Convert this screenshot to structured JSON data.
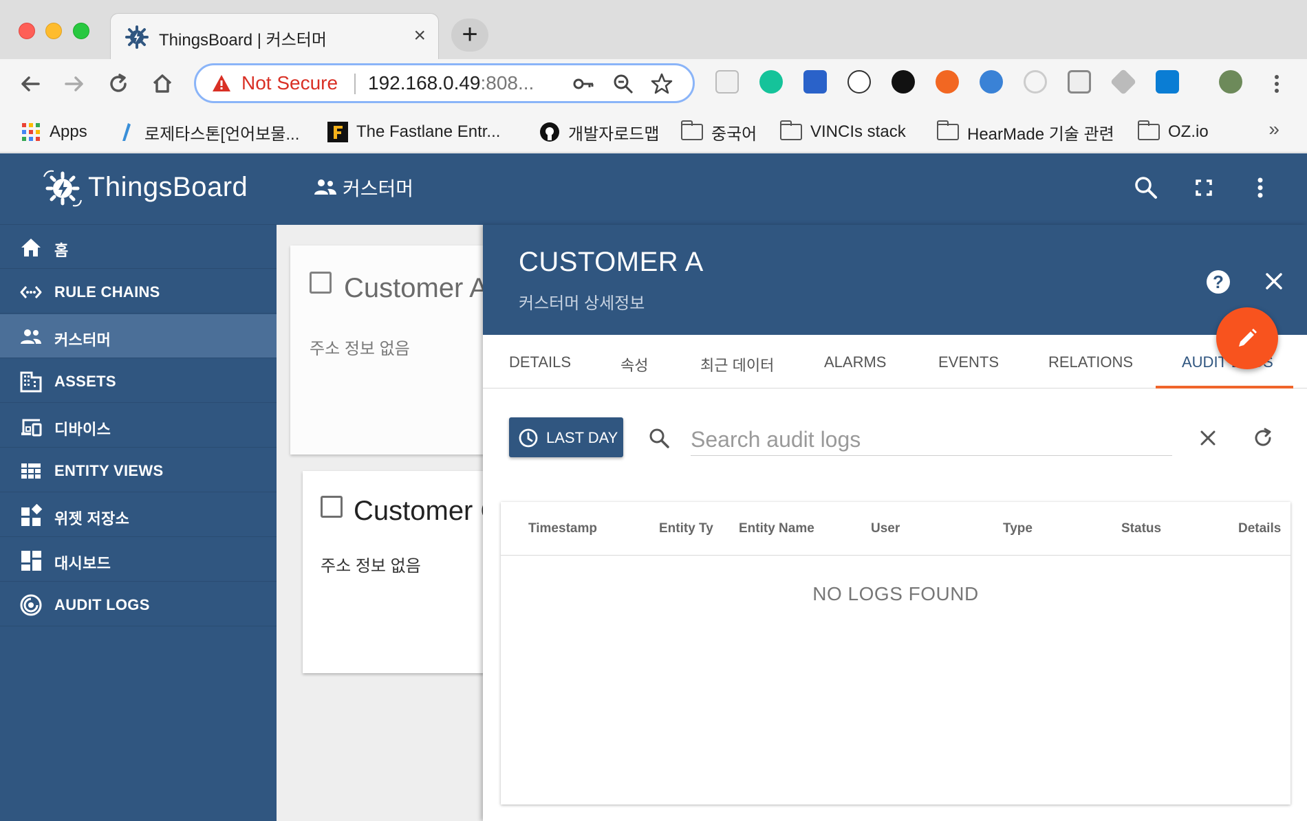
{
  "browser": {
    "tab_title": "ThingsBoard | 커스터머",
    "tab_close": "×",
    "new_tab": "+",
    "security_label": "Not Secure",
    "url_host": "192.168.0.49",
    "url_rest": ":808...",
    "extensions": [
      "pocket-icon",
      "grammarly-icon",
      "bookmark-icon",
      "json-viewer-icon",
      "clock-icon",
      "lifesaver-icon",
      "globe-icon",
      "g-icon",
      "window-icon",
      "tag-icon",
      "trello-icon",
      "avatar"
    ]
  },
  "bookmarks": [
    {
      "label": "Apps",
      "icon": "apps-grid-icon"
    },
    {
      "label": "로제타스톤[언어보물...",
      "icon": "rosetta-icon"
    },
    {
      "label": "The Fastlane Entr...",
      "icon": "fastlane-icon"
    },
    {
      "label": "개발자로드맵",
      "icon": "github-icon"
    },
    {
      "label": "중국어",
      "icon": "folder-icon"
    },
    {
      "label": "VINCIs stack",
      "icon": "folder-icon"
    },
    {
      "label": "HearMade 기술 관련",
      "icon": "folder-icon"
    },
    {
      "label": "OZ.io",
      "icon": "folder-icon"
    }
  ],
  "bookmarks_more": "»",
  "app": {
    "brand": "ThingsBoard",
    "page_title": "커스터머",
    "colors": {
      "primary": "#305680",
      "accent": "#f8531e",
      "active": "#4b6f98"
    }
  },
  "sidebar": {
    "items": [
      {
        "label": "홈",
        "icon": "home-icon"
      },
      {
        "label": "RULE CHAINS",
        "icon": "rule-chains-icon"
      },
      {
        "label": "커스터머",
        "icon": "customers-icon",
        "active": true
      },
      {
        "label": "ASSETS",
        "icon": "assets-icon"
      },
      {
        "label": "디바이스",
        "icon": "devices-icon"
      },
      {
        "label": "ENTITY VIEWS",
        "icon": "entity-views-icon"
      },
      {
        "label": "위젯 저장소",
        "icon": "widgets-icon"
      },
      {
        "label": "대시보드",
        "icon": "dashboards-icon"
      },
      {
        "label": "AUDIT LOGS",
        "icon": "audit-logs-icon"
      }
    ]
  },
  "cards": [
    {
      "name": "Customer A",
      "address": "주소 정보 없음"
    },
    {
      "name": "Customer C",
      "address": "주소 정보 없음"
    }
  ],
  "detail": {
    "title": "CUSTOMER A",
    "subtitle": "커스터머 상세정보",
    "help": "?",
    "tabs": [
      "DETAILS",
      "속성",
      "최근 데이터",
      "ALARMS",
      "EVENTS",
      "RELATIONS",
      "AUDIT LOGS"
    ],
    "active_tab": "AUDIT LOGS",
    "time_button": "LAST DAY",
    "search_placeholder": "Search audit logs",
    "columns": [
      "Timestamp",
      "Entity Type",
      "Entity Name",
      "User",
      "Type",
      "Status",
      "Details"
    ],
    "empty_message": "NO LOGS FOUND"
  }
}
